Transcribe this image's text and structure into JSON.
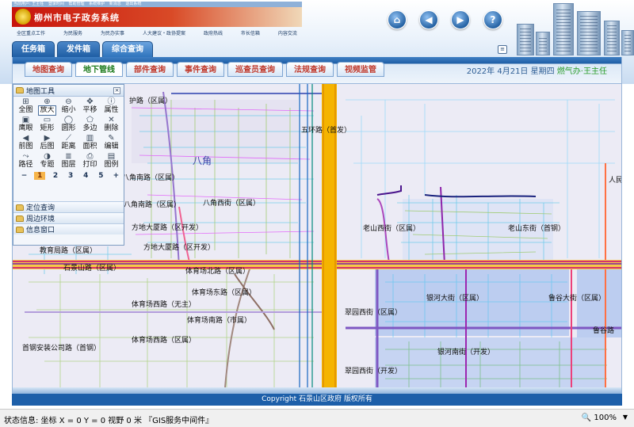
{
  "header": {
    "top_links": [
      "当前用户: 王主任",
      "登录时间",
      "帮助管理",
      "系统维护",
      "新消息",
      "退出系统"
    ],
    "system_title": "柳州市电子政务系统",
    "site_nav": [
      "全区重点工作",
      "为民服务",
      "为民办实事",
      "人大建议・政协提案",
      "政府热线",
      "市长信箱",
      "内容交流"
    ],
    "buttons": {
      "home": "⌂",
      "back": "◀",
      "forward": "▶",
      "help": "?"
    }
  },
  "main_tabs": [
    {
      "label": "任务箱",
      "active": false
    },
    {
      "label": "发件箱",
      "active": false
    },
    {
      "label": "综合查询",
      "active": true
    }
  ],
  "sub_tabs": [
    {
      "label": "地图查询",
      "active": false
    },
    {
      "label": "地下管线",
      "active": true
    },
    {
      "label": "部件查询",
      "active": false
    },
    {
      "label": "事件查询",
      "active": false
    },
    {
      "label": "巡查员查询",
      "active": false
    },
    {
      "label": "法规查询",
      "active": false
    },
    {
      "label": "视频监管",
      "active": false
    }
  ],
  "date_line": {
    "date": "2022年 4月21日 星期四",
    "user": "燃气办·王主任"
  },
  "tool_panel": {
    "title": "地图工具",
    "close": "×",
    "tools": [
      {
        "name": "tool-full-extent",
        "icon": "⊞",
        "label": "全图"
      },
      {
        "name": "tool-zoom-in",
        "icon": "⊕",
        "label": "放大",
        "active": true
      },
      {
        "name": "tool-zoom-out",
        "icon": "⊖",
        "label": "缩小"
      },
      {
        "name": "tool-pan",
        "icon": "✥",
        "label": "平移"
      },
      {
        "name": "tool-attributes",
        "icon": "ⓘ",
        "label": "属性"
      },
      {
        "name": "tool-eagle-eye",
        "icon": "▣",
        "label": "鹰眼"
      },
      {
        "name": "tool-rectangle",
        "icon": "▭",
        "label": "矩形"
      },
      {
        "name": "tool-circle",
        "icon": "◯",
        "label": "圆形"
      },
      {
        "name": "tool-polygon",
        "icon": "⬠",
        "label": "多边"
      },
      {
        "name": "tool-delete",
        "icon": "✕",
        "label": "删除"
      },
      {
        "name": "tool-previous-view",
        "icon": "◀",
        "label": "前图"
      },
      {
        "name": "tool-next-view",
        "icon": "▶",
        "label": "后图"
      },
      {
        "name": "tool-distance",
        "icon": "⟋",
        "label": "距离"
      },
      {
        "name": "tool-area",
        "icon": "▥",
        "label": "面积"
      },
      {
        "name": "tool-edit",
        "icon": "✎",
        "label": "编辑"
      },
      {
        "name": "tool-route",
        "icon": "⤳",
        "label": "路径"
      },
      {
        "name": "tool-thematic",
        "icon": "◑",
        "label": "专题"
      },
      {
        "name": "tool-layers",
        "icon": "≣",
        "label": "图层"
      },
      {
        "name": "tool-print",
        "icon": "⎙",
        "label": "打印"
      },
      {
        "name": "tool-legend",
        "icon": "▤",
        "label": "图例"
      }
    ],
    "zoom_minus": "−",
    "zoom_levels": [
      "1",
      "2",
      "3",
      "4",
      "5"
    ],
    "active_zoom_level": "1",
    "zoom_plus": "+"
  },
  "accordion": [
    "定位查询",
    "周边环境",
    "信息窗口"
  ],
  "map_labels": [
    "护路（区属）",
    "五环路（首发）",
    "八角",
    "八角南路（区属）",
    "八角西街（区属）",
    "八角南路（区属）",
    "方地大厦路（区开发）",
    "方地大厦路（区开发）",
    "老山西街（区属）",
    "老山东街（首钢）",
    "人民",
    "教育局路（区属）",
    "石景山路（区属）",
    "体育场北路（区属）",
    "体育场东路（区属）",
    "体育场西路（无主）",
    "体育场南路（市属）",
    "翠园西街（区属）",
    "银河大街（区属）",
    "鲁谷大街（区属）",
    "鲁谷路",
    "首钢安装公司路（首钢）",
    "体育场西路（区属）",
    "银河南街（开发）",
    "翠园西街（开发）"
  ],
  "footer": {
    "copyright": "Copyright 石景山区政府 版权所有"
  },
  "status_bar": {
    "text": "状态信息:  坐标 X = 0 Y = 0 视野 0 米  『GIS服务中间件』",
    "zoom": "100%",
    "caret": "▼"
  },
  "colors": {
    "primary_blue": "#1d5fa9",
    "active_tab_text": "#1b7a1b",
    "inactive_tab_text": "#c0392b",
    "main_road": "#f5b400"
  }
}
